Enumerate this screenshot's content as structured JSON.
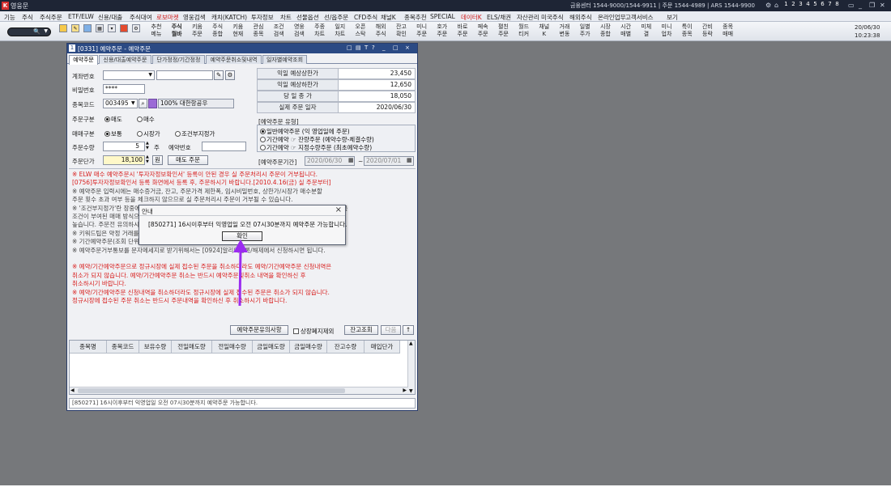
{
  "app": {
    "title": "영웅문",
    "logo": "K",
    "info": "금융센터 1544-9000/1544-9911 | 주문 1544-4989 | ARS 1544-9900",
    "pages": [
      "1",
      "2",
      "3",
      "4",
      "5",
      "6",
      "7",
      "8"
    ]
  },
  "menu": [
    {
      "label": "기능"
    },
    {
      "label": "주식"
    },
    {
      "label": "주식주문"
    },
    {
      "label": "ETF/ELW"
    },
    {
      "label": "신용/대출"
    },
    {
      "label": "주식대여"
    },
    {
      "label": "로보마켓",
      "red": true
    },
    {
      "label": "영웅검색"
    },
    {
      "label": "캐치(KATCH)"
    },
    {
      "label": "투자정보"
    },
    {
      "label": "차트"
    },
    {
      "label": "선물옵션"
    },
    {
      "label": "선/옵주문"
    },
    {
      "label": "CFD주식"
    },
    {
      "label": "채널K"
    },
    {
      "label": "종목추천"
    },
    {
      "label": "SPECIAL"
    },
    {
      "label": "데이터K",
      "red": true
    },
    {
      "label": "ELS/채권"
    },
    {
      "label": "자산관리"
    },
    {
      "label": "미국주식"
    },
    {
      "label": "해외주식"
    },
    {
      "label": "온라인업무"
    },
    {
      "label": "고객서비스"
    },
    {
      "label": "보기"
    }
  ],
  "toolbar": {
    "buttons": [
      {
        "l1": "추천",
        "l2": "메뉴"
      },
      {
        "l1": "주식",
        "l2": "월바",
        "bold": true
      },
      {
        "l1": "키움",
        "l2": "주문"
      },
      {
        "l1": "주식",
        "l2": "종합"
      },
      {
        "l1": "키움",
        "l2": "현재"
      },
      {
        "l1": "관심",
        "l2": "종목"
      },
      {
        "l1": "조건",
        "l2": "검색"
      },
      {
        "l1": "영웅",
        "l2": "검색"
      },
      {
        "l1": "주종",
        "l2": "차트"
      },
      {
        "l1": "일지",
        "l2": "차트"
      },
      {
        "l1": "오픈",
        "l2": "스탁"
      },
      {
        "l1": "해외",
        "l2": "주식"
      },
      {
        "l1": "잔고",
        "l2": "확인"
      },
      {
        "l1": "미니",
        "l2": "주문"
      },
      {
        "l1": "호가",
        "l2": "주문"
      },
      {
        "l1": "바로",
        "l2": "주문"
      },
      {
        "l1": "페속",
        "l2": "주문"
      },
      {
        "l1": "펼친",
        "l2": "주문"
      },
      {
        "l1": "월드",
        "l2": "티커"
      },
      {
        "l1": "채널",
        "l2": "K"
      },
      {
        "l1": "거래",
        "l2": "변동"
      },
      {
        "l1": "일별",
        "l2": "주가"
      },
      {
        "l1": "시장",
        "l2": "종합"
      },
      {
        "l1": "시간",
        "l2": "매별"
      },
      {
        "l1": "미체",
        "l2": "결"
      },
      {
        "l1": "미니",
        "l2": "업차"
      },
      {
        "l1": "특이",
        "l2": "종목"
      },
      {
        "l1": "간비",
        "l2": "등락"
      },
      {
        "l1": "종목",
        "l2": "매매"
      }
    ],
    "date": "20/06/30",
    "time": "10:23:38"
  },
  "window": {
    "num": "1",
    "title": "[0331] 예약주문 - 예약주문",
    "controls": [
      "□",
      "▤",
      "T",
      "?",
      "_",
      "□",
      "×"
    ],
    "tabs": [
      "예약주문",
      "신용/대출예약주문",
      "단가정정/기간정정",
      "예약주문취소및내역",
      "일자별예약조회"
    ],
    "form": {
      "acct_label": "계좌번호",
      "pw_label": "비밀번호",
      "pw_value": "****",
      "code_label": "종목코드",
      "code_value": "003495",
      "pct": "100%",
      "stock_name": "대한항공우",
      "ordtype_label": "주문구분",
      "sell": "매도",
      "buy": "매수",
      "tradetype_label": "매매구분",
      "normal": "보통",
      "market": "시장가",
      "conditional": "조건부지정가",
      "qty_label": "주문수량",
      "qty_value": "5",
      "qty_unit": "주",
      "resno_label": "예약번호",
      "price_label": "주문단가",
      "price_value": "18,100",
      "price_unit": "원",
      "submit": "매도 주문"
    },
    "prices": [
      {
        "k": "익일 예상상한가",
        "v": "23,450"
      },
      {
        "k": "익일 예상하한가",
        "v": "12,650"
      },
      {
        "k": "당 일 종 가",
        "v": "18,050"
      },
      {
        "k": "실제 주문 일자",
        "v": "2020/06/30"
      }
    ],
    "restype": {
      "title": "[예약주문 유형]",
      "opt1": "일반예약주문 (익 영업일에 주문)",
      "opt2": "기간예약 ☞ 잔량주문 (예약수량-체결수량)",
      "opt3": "기간예약 ☞ 지정수량주문 (최초예약수량)"
    },
    "period": {
      "label": "[예약주문기간]",
      "from": "2020/06/30",
      "sep": "~",
      "to": "2020/07/01"
    },
    "notes": [
      {
        "t": "※ ELW 매수 예약주문시 '투자자정보확인서' 등록이 안된 경우 실 주문처리시 주문이 거부됩니다.",
        "red": true
      },
      {
        "t": "   [0756]투자자정보확인서 등록 화면에서 등록 후, 주문하시기 바랍니다.[2010.4.16(금) 실 주문부터]",
        "red": true
      },
      {
        "t": "※ 예약주문 입력시에는 매수증거금, 잔고, 주문가격 제한폭, 임시비밀번호, 상한가/시장가 매수분할",
        "red": false
      },
      {
        "t": "   주문 횟수 초과 여부 등을 체크하지 않으므로 실 주문처리시 주문이 거부될 수 있습니다.",
        "red": false
      },
      {
        "t": "※ '조건부지정가'란 장중에는 지정가주문으로 처리되며 장종료 후 체결되지 않은 잔량은 시장가로 전환되도록",
        "red": false
      },
      {
        "t": "   조건이 부여된 매매 방식으로, 장 종료 시 전환된 시장가 주문은 불리한 가격에 체결될 수 있는 가능성이",
        "red": false
      },
      {
        "t": "   높습니다. 주문전 유의하시기 바랍니다.",
        "red": false
      },
      {
        "t": "※ 키워드팁은 약정 거래를 기준으로 생성됩니다.",
        "red": false
      },
      {
        "t": "※ 기간예약주문(조회 단위)은 영업일 기준 최대 30영업일 가능합니다.",
        "red": false
      },
      {
        "t": "※ 예약주문거부통보를 문자메세지로 받기위해서는 [0924]알리미등록/해제에서 신청하시면 됩니다.",
        "red": false
      },
      {
        "t": "",
        "red": false
      },
      {
        "t": "※ 예약/기간예약주문으로 정규시장에 실제 접수된 주문을 취소하더라도 예약/기간예약주문 신청내역은",
        "red": true
      },
      {
        "t": "   취소가 되지 않습니다. 예약/기간예약주문 취소는 반드시 예약주문및취소 내역을 확인하신 후",
        "red": true
      },
      {
        "t": "   취소하시기 바랍니다.",
        "red": true
      },
      {
        "t": "※ 예약/기간예약주문 신청내역을 취소하더라도 정규시장에 실제 접수된 주문은 취소가 되지 않습니다.",
        "red": true
      },
      {
        "t": "   정규시장에 접수된 주문 취소는 반드시 주문내역을 확인하신 후 취소하시기 바랍니다.",
        "red": true
      }
    ],
    "actions": {
      "notice": "예약주문유의사항",
      "checkbox": "상장폐지제외",
      "query": "잔고조회",
      "next": "다음",
      "up": "↑"
    },
    "grid_headers": [
      "종목명",
      "종목코드",
      "보유수량",
      "전일매도량",
      "전일매수량",
      "금일매도량",
      "금일매수량",
      "잔고수량",
      "매입단가"
    ],
    "status": "[850271] 16시이후부터 익영업일 오전 07시30분까지 예약주문 가능합니다."
  },
  "dialog": {
    "title": "안내",
    "message": "[850271] 16시이후부터 익영업일 오전 07시30분까지 예약주문 가능합니다.",
    "ok": "확인",
    "close": "×"
  },
  "annotation_color": "#9b2cf0"
}
